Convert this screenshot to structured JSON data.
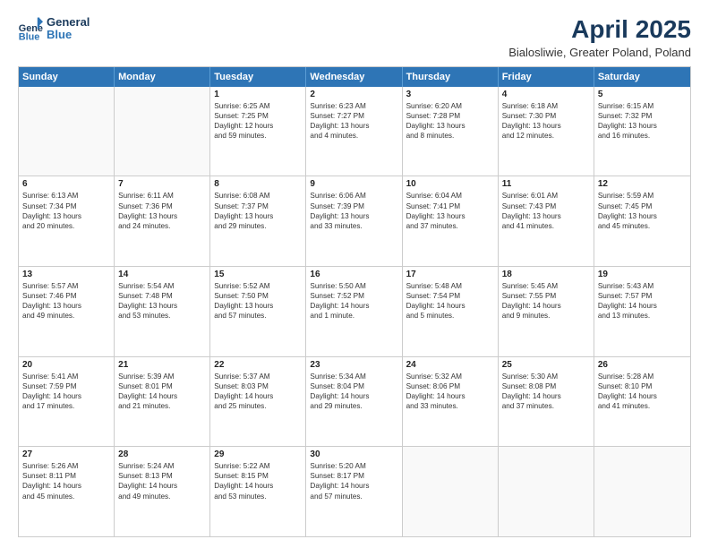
{
  "logo": {
    "line1": "General",
    "line2": "Blue"
  },
  "title": "April 2025",
  "subtitle": "Bialosliwie, Greater Poland, Poland",
  "header_days": [
    "Sunday",
    "Monday",
    "Tuesday",
    "Wednesday",
    "Thursday",
    "Friday",
    "Saturday"
  ],
  "weeks": [
    [
      {
        "day": "",
        "lines": []
      },
      {
        "day": "",
        "lines": []
      },
      {
        "day": "1",
        "lines": [
          "Sunrise: 6:25 AM",
          "Sunset: 7:25 PM",
          "Daylight: 12 hours",
          "and 59 minutes."
        ]
      },
      {
        "day": "2",
        "lines": [
          "Sunrise: 6:23 AM",
          "Sunset: 7:27 PM",
          "Daylight: 13 hours",
          "and 4 minutes."
        ]
      },
      {
        "day": "3",
        "lines": [
          "Sunrise: 6:20 AM",
          "Sunset: 7:28 PM",
          "Daylight: 13 hours",
          "and 8 minutes."
        ]
      },
      {
        "day": "4",
        "lines": [
          "Sunrise: 6:18 AM",
          "Sunset: 7:30 PM",
          "Daylight: 13 hours",
          "and 12 minutes."
        ]
      },
      {
        "day": "5",
        "lines": [
          "Sunrise: 6:15 AM",
          "Sunset: 7:32 PM",
          "Daylight: 13 hours",
          "and 16 minutes."
        ]
      }
    ],
    [
      {
        "day": "6",
        "lines": [
          "Sunrise: 6:13 AM",
          "Sunset: 7:34 PM",
          "Daylight: 13 hours",
          "and 20 minutes."
        ]
      },
      {
        "day": "7",
        "lines": [
          "Sunrise: 6:11 AM",
          "Sunset: 7:36 PM",
          "Daylight: 13 hours",
          "and 24 minutes."
        ]
      },
      {
        "day": "8",
        "lines": [
          "Sunrise: 6:08 AM",
          "Sunset: 7:37 PM",
          "Daylight: 13 hours",
          "and 29 minutes."
        ]
      },
      {
        "day": "9",
        "lines": [
          "Sunrise: 6:06 AM",
          "Sunset: 7:39 PM",
          "Daylight: 13 hours",
          "and 33 minutes."
        ]
      },
      {
        "day": "10",
        "lines": [
          "Sunrise: 6:04 AM",
          "Sunset: 7:41 PM",
          "Daylight: 13 hours",
          "and 37 minutes."
        ]
      },
      {
        "day": "11",
        "lines": [
          "Sunrise: 6:01 AM",
          "Sunset: 7:43 PM",
          "Daylight: 13 hours",
          "and 41 minutes."
        ]
      },
      {
        "day": "12",
        "lines": [
          "Sunrise: 5:59 AM",
          "Sunset: 7:45 PM",
          "Daylight: 13 hours",
          "and 45 minutes."
        ]
      }
    ],
    [
      {
        "day": "13",
        "lines": [
          "Sunrise: 5:57 AM",
          "Sunset: 7:46 PM",
          "Daylight: 13 hours",
          "and 49 minutes."
        ]
      },
      {
        "day": "14",
        "lines": [
          "Sunrise: 5:54 AM",
          "Sunset: 7:48 PM",
          "Daylight: 13 hours",
          "and 53 minutes."
        ]
      },
      {
        "day": "15",
        "lines": [
          "Sunrise: 5:52 AM",
          "Sunset: 7:50 PM",
          "Daylight: 13 hours",
          "and 57 minutes."
        ]
      },
      {
        "day": "16",
        "lines": [
          "Sunrise: 5:50 AM",
          "Sunset: 7:52 PM",
          "Daylight: 14 hours",
          "and 1 minute."
        ]
      },
      {
        "day": "17",
        "lines": [
          "Sunrise: 5:48 AM",
          "Sunset: 7:54 PM",
          "Daylight: 14 hours",
          "and 5 minutes."
        ]
      },
      {
        "day": "18",
        "lines": [
          "Sunrise: 5:45 AM",
          "Sunset: 7:55 PM",
          "Daylight: 14 hours",
          "and 9 minutes."
        ]
      },
      {
        "day": "19",
        "lines": [
          "Sunrise: 5:43 AM",
          "Sunset: 7:57 PM",
          "Daylight: 14 hours",
          "and 13 minutes."
        ]
      }
    ],
    [
      {
        "day": "20",
        "lines": [
          "Sunrise: 5:41 AM",
          "Sunset: 7:59 PM",
          "Daylight: 14 hours",
          "and 17 minutes."
        ]
      },
      {
        "day": "21",
        "lines": [
          "Sunrise: 5:39 AM",
          "Sunset: 8:01 PM",
          "Daylight: 14 hours",
          "and 21 minutes."
        ]
      },
      {
        "day": "22",
        "lines": [
          "Sunrise: 5:37 AM",
          "Sunset: 8:03 PM",
          "Daylight: 14 hours",
          "and 25 minutes."
        ]
      },
      {
        "day": "23",
        "lines": [
          "Sunrise: 5:34 AM",
          "Sunset: 8:04 PM",
          "Daylight: 14 hours",
          "and 29 minutes."
        ]
      },
      {
        "day": "24",
        "lines": [
          "Sunrise: 5:32 AM",
          "Sunset: 8:06 PM",
          "Daylight: 14 hours",
          "and 33 minutes."
        ]
      },
      {
        "day": "25",
        "lines": [
          "Sunrise: 5:30 AM",
          "Sunset: 8:08 PM",
          "Daylight: 14 hours",
          "and 37 minutes."
        ]
      },
      {
        "day": "26",
        "lines": [
          "Sunrise: 5:28 AM",
          "Sunset: 8:10 PM",
          "Daylight: 14 hours",
          "and 41 minutes."
        ]
      }
    ],
    [
      {
        "day": "27",
        "lines": [
          "Sunrise: 5:26 AM",
          "Sunset: 8:11 PM",
          "Daylight: 14 hours",
          "and 45 minutes."
        ]
      },
      {
        "day": "28",
        "lines": [
          "Sunrise: 5:24 AM",
          "Sunset: 8:13 PM",
          "Daylight: 14 hours",
          "and 49 minutes."
        ]
      },
      {
        "day": "29",
        "lines": [
          "Sunrise: 5:22 AM",
          "Sunset: 8:15 PM",
          "Daylight: 14 hours",
          "and 53 minutes."
        ]
      },
      {
        "day": "30",
        "lines": [
          "Sunrise: 5:20 AM",
          "Sunset: 8:17 PM",
          "Daylight: 14 hours",
          "and 57 minutes."
        ]
      },
      {
        "day": "",
        "lines": []
      },
      {
        "day": "",
        "lines": []
      },
      {
        "day": "",
        "lines": []
      }
    ]
  ]
}
